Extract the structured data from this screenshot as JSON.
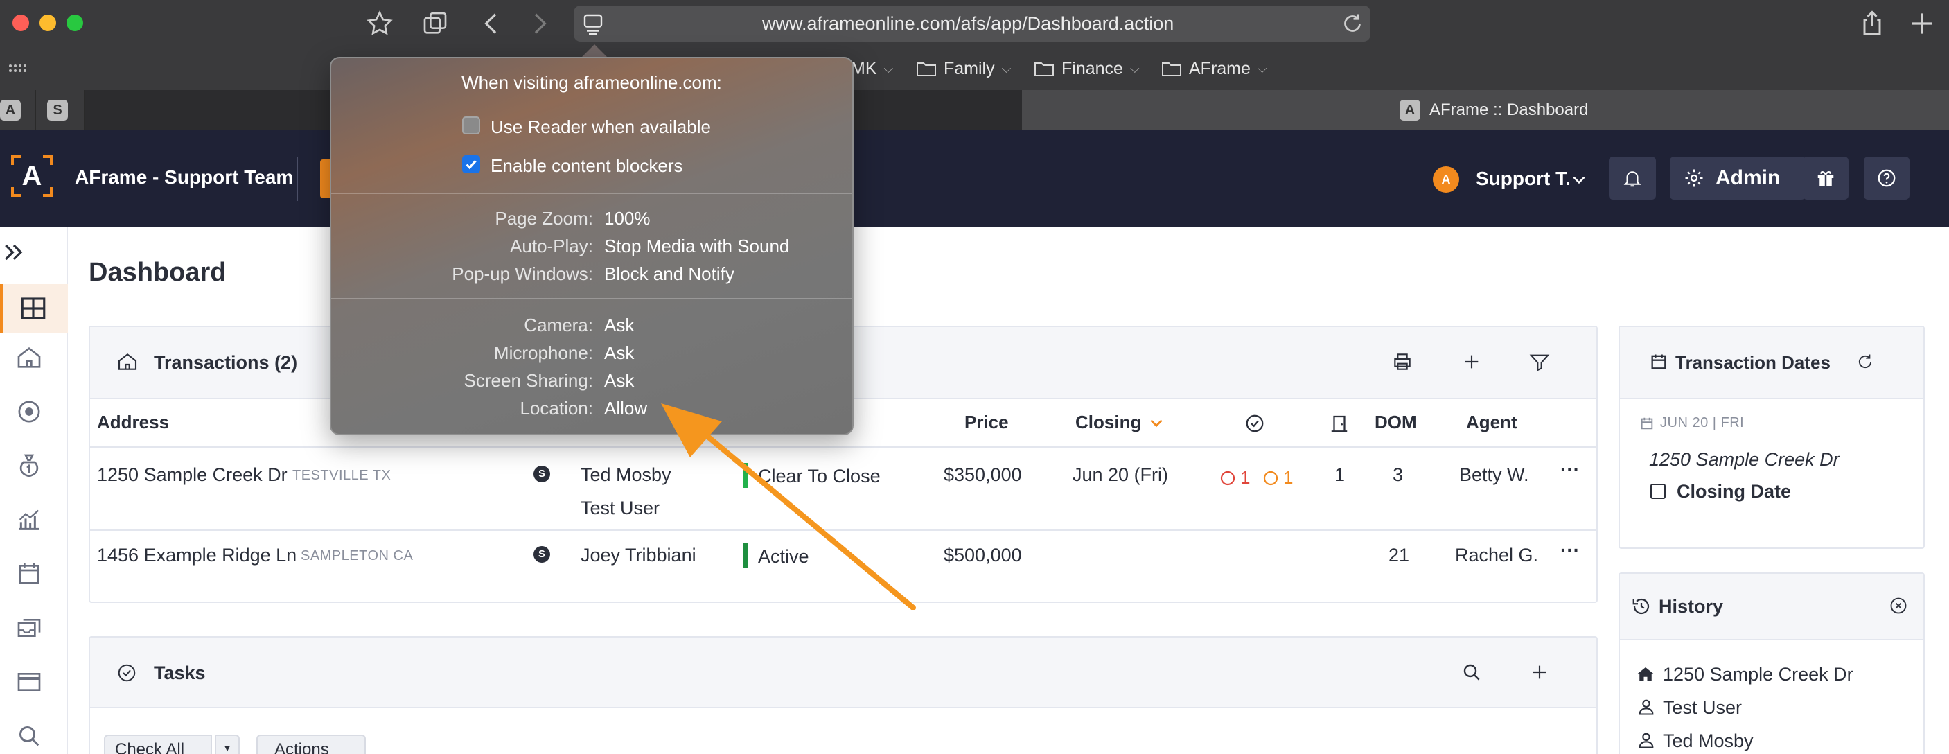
{
  "browser": {
    "url": "www.aframeonline.com/afs/app/Dashboard.action",
    "bookmarks": [
      {
        "label": "MK"
      },
      {
        "label": "Family"
      },
      {
        "label": "Finance"
      },
      {
        "label": "AFrame"
      }
    ],
    "tabs": [
      {
        "badge": "A"
      },
      {
        "badge": "S"
      }
    ],
    "active_tab": {
      "badge": "A",
      "title": "AFrame :: Dashboard"
    }
  },
  "popover": {
    "heading": "When visiting aframeonline.com:",
    "options": [
      {
        "label": "Use Reader when available",
        "checked": false
      },
      {
        "label": "Enable content blockers",
        "checked": true
      }
    ],
    "settings_group1": [
      {
        "label": "Page Zoom:",
        "value": "100%"
      },
      {
        "label": "Auto-Play:",
        "value": "Stop Media with Sound"
      },
      {
        "label": "Pop-up Windows:",
        "value": "Block and Notify"
      }
    ],
    "settings_group2": [
      {
        "label": "Camera:",
        "value": "Ask"
      },
      {
        "label": "Microphone:",
        "value": "Ask"
      },
      {
        "label": "Screen Sharing:",
        "value": "Ask"
      },
      {
        "label": "Location:",
        "value": "Allow"
      }
    ]
  },
  "header": {
    "logo": "A",
    "team": "AFrame - Support Team",
    "user_badge": "A",
    "user_name": "Support T.",
    "admin_label": "Admin"
  },
  "page": {
    "title": "Dashboard"
  },
  "transactions": {
    "title": "Transactions (2)",
    "columns": {
      "address": "Address",
      "price": "Price",
      "closing": "Closing",
      "dom": "DOM",
      "agent": "Agent"
    },
    "rows": [
      {
        "address": "1250 Sample Creek Dr",
        "city": "TESTVILLE TX",
        "badge": "S",
        "client1": "Ted Mosby",
        "client2": "Test User",
        "status": "Clear To Close",
        "price": "$350,000",
        "closing": "Jun 20 (Fri)",
        "red_count": "1",
        "orange_count": "1",
        "docs": "1",
        "dom": "3",
        "agent": "Betty W.",
        "more": "···"
      },
      {
        "address": "1456 Example Ridge Ln",
        "city": "SAMPLETON CA",
        "badge": "S",
        "client1": "Joey Tribbiani",
        "status": "Active",
        "price": "$500,000",
        "dom": "21",
        "agent": "Rachel G.",
        "more": "···"
      }
    ]
  },
  "tasks": {
    "title": "Tasks",
    "check_all": "Check All",
    "actions": "Actions"
  },
  "transaction_dates": {
    "title": "Transaction Dates",
    "date": "JUN 20 | FRI",
    "address": "1250 Sample Creek Dr",
    "event": "Closing Date"
  },
  "history": {
    "title": "History",
    "items": [
      {
        "label": "1250 Sample Creek Dr",
        "icon": "home-icon"
      },
      {
        "label": "Test User",
        "icon": "person-icon"
      },
      {
        "label": "Ted Mosby",
        "icon": "person-icon"
      }
    ]
  },
  "colors": {
    "accent": "#f28a1e",
    "header_bg": "#1f2236",
    "status_green": "#22b14c",
    "alert_red": "#e0453a",
    "alert_orange": "#f28a1e"
  }
}
